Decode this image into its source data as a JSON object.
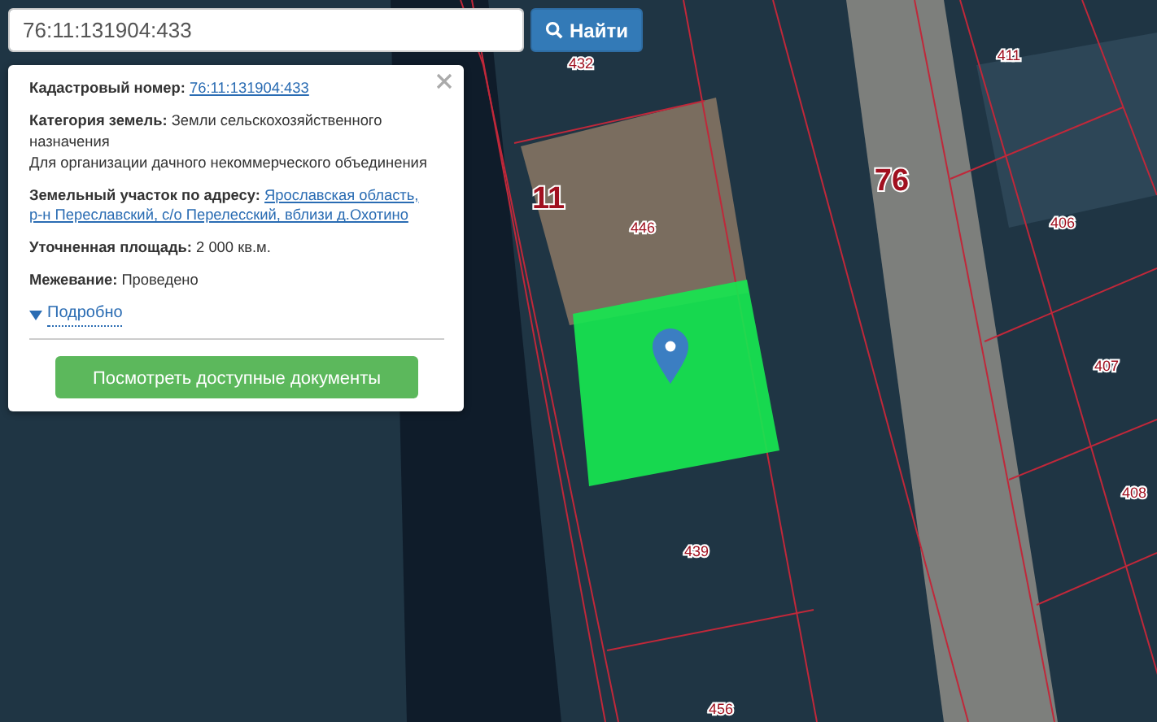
{
  "search": {
    "value": "76:11:131904:433",
    "button": "Найти"
  },
  "info_panel": {
    "fields": [
      {
        "label": "Кадастровый номер:",
        "link_lines": [
          "76:11:131904:433"
        ]
      },
      {
        "label": "Категория земель:",
        "lines": [
          "Земли сельскохозяйственного назначения",
          "Для организации дачного некоммерческого объединения"
        ]
      },
      {
        "label": "Земельный участок по адресу:",
        "link_lines": [
          "Ярославская область,",
          "р-н Переславский, с/о Перелесский, вблизи д.Охотино"
        ]
      },
      {
        "label": "Уточненная площадь:",
        "lines": [
          "2 000 кв.м."
        ]
      },
      {
        "label": "Межевание:",
        "lines": [
          "Проведено"
        ]
      }
    ],
    "details_toggle": {
      "label": "Подробно",
      "expanded": false
    },
    "documents_button": "Посмотреть доступные документы"
  },
  "map": {
    "parcel_labels": [
      {
        "text": "432",
        "kind": "small"
      },
      {
        "text": "411",
        "kind": "small"
      },
      {
        "text": "11",
        "kind": "large"
      },
      {
        "text": "76",
        "kind": "large"
      },
      {
        "text": "446",
        "kind": "small"
      },
      {
        "text": "406",
        "kind": "small"
      },
      {
        "text": "407",
        "kind": "small"
      },
      {
        "text": "408",
        "kind": "small"
      },
      {
        "text": "439",
        "kind": "small"
      },
      {
        "text": "456",
        "kind": "small"
      }
    ]
  }
}
